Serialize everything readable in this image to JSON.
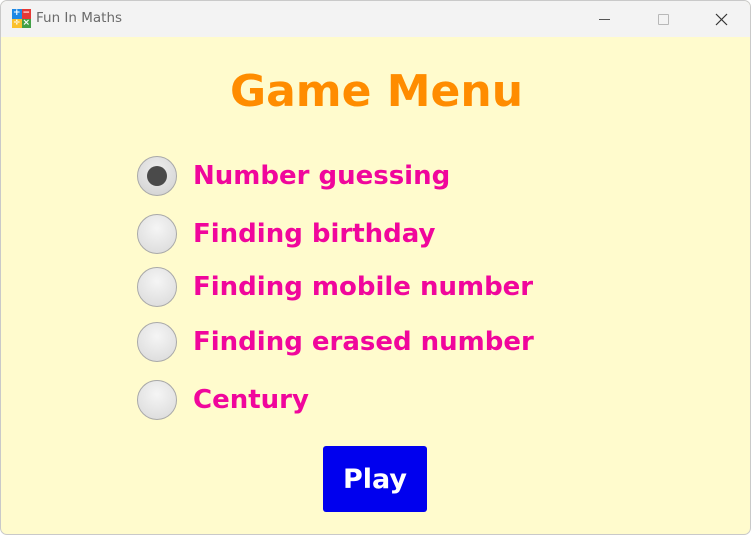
{
  "window": {
    "title": "Fun In Maths",
    "app_icon": {
      "name": "math-operators-icon",
      "glyphs": [
        "+",
        "−",
        "÷",
        "×"
      ],
      "colors": [
        "#1e88e5",
        "#e53935",
        "#fbc02d",
        "#43a047"
      ]
    },
    "controls": [
      "minimize-icon",
      "maximize-icon",
      "close-icon"
    ]
  },
  "menu": {
    "title": "Game Menu",
    "options": [
      {
        "label": "Number guessing",
        "checked": true
      },
      {
        "label": "Finding birthday",
        "checked": false
      },
      {
        "label": "Finding mobile number",
        "checked": false
      },
      {
        "label": "Finding erased number",
        "checked": false
      },
      {
        "label": "Century",
        "checked": false
      }
    ],
    "play_label": "Play"
  },
  "colors": {
    "background": "#fffbcd",
    "title": "#ff8c00",
    "option_text": "#f0069c",
    "play_button": "#0000ee",
    "play_text": "#ffffff"
  }
}
